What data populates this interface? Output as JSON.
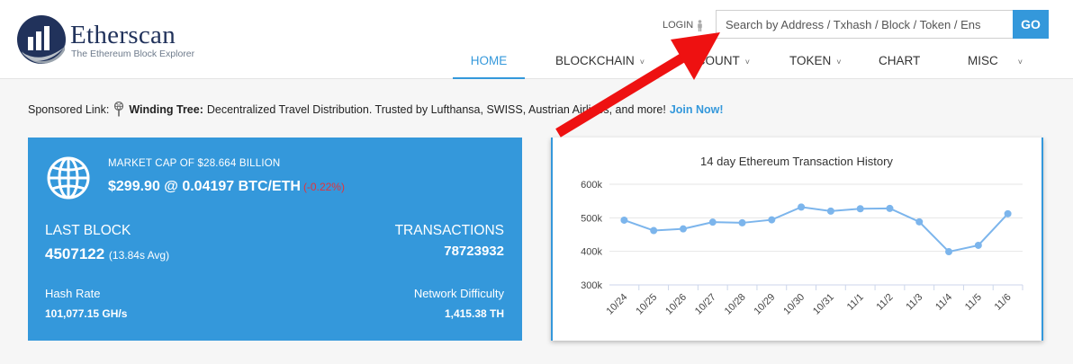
{
  "brand": {
    "name": "Etherscan",
    "tagline": "The Ethereum Block Explorer"
  },
  "header": {
    "login_label": "LOGIN",
    "search_placeholder": "Search by Address / Txhash / Block / Token / Ens",
    "go_label": "GO"
  },
  "nav": {
    "items": [
      {
        "label": "HOME",
        "active": true
      },
      {
        "label": "BLOCKCHAIN",
        "caret": "˅"
      },
      {
        "label": "ACCOUNT",
        "caret": "˅"
      },
      {
        "label": "TOKEN",
        "caret": "˅"
      },
      {
        "label": "CHART"
      },
      {
        "label": "MISC",
        "caret": "˅"
      }
    ]
  },
  "sponsor": {
    "prefix": "Sponsored Link:",
    "name": "Winding Tree:",
    "text": "Decentralized Travel Distribution. Trusted by Lufthansa, SWISS, Austrian Airlines, and more!",
    "cta": "Join Now!"
  },
  "stats": {
    "market_cap_label": "MARKET CAP OF $28.664 BILLION",
    "price": "$299.90 @ 0.04197 BTC/ETH",
    "price_change": "(-0.22%)",
    "last_block_label": "LAST BLOCK",
    "last_block_value": "4507122",
    "last_block_avg": "(13.84s Avg)",
    "transactions_label": "TRANSACTIONS",
    "transactions_value": "78723932",
    "hash_rate_label": "Hash Rate",
    "hash_rate_value": "101,077.15 GH/s",
    "difficulty_label": "Network Difficulty",
    "difficulty_value": "1,415.38 TH"
  },
  "colors": {
    "accent": "#3498db",
    "price_change": "#e3323b",
    "annotation_arrow": "#ee1111",
    "series_line": "#7cb5ec"
  },
  "chart_data": {
    "type": "line",
    "title": "14 day Ethereum Transaction History",
    "categories": [
      "10/24",
      "10/25",
      "10/26",
      "10/27",
      "10/28",
      "10/29",
      "10/30",
      "10/31",
      "11/1",
      "11/2",
      "11/3",
      "11/4",
      "11/5",
      "11/6"
    ],
    "values": [
      493000,
      462000,
      467000,
      487000,
      485000,
      494000,
      532000,
      520000,
      527000,
      528000,
      488000,
      399000,
      418000,
      512000
    ],
    "y_ticks": [
      "300k",
      "400k",
      "500k",
      "600k"
    ],
    "ylim": [
      300000,
      600000
    ],
    "grid": true,
    "legend": "none"
  }
}
